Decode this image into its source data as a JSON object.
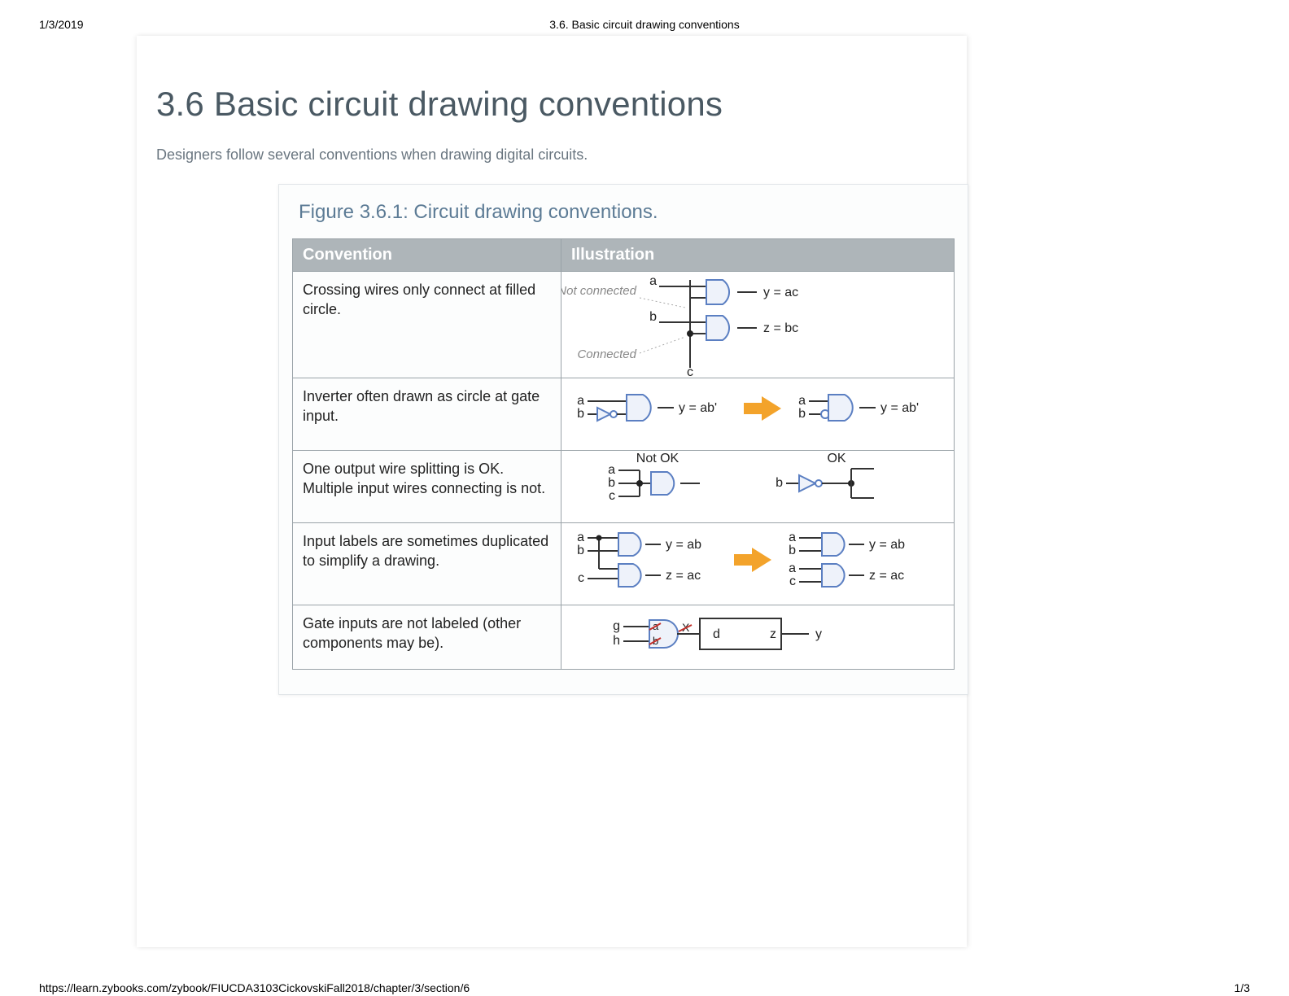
{
  "print": {
    "date": "1/3/2019",
    "header_title": "3.6. Basic circuit drawing conventions",
    "url": "https://learn.zybooks.com/zybook/FIUCDA3103CickovskiFall2018/chapter/3/section/6",
    "page_num": "1/3"
  },
  "title": "3.6 Basic circuit drawing conventions",
  "intro": "Designers follow several conventions when drawing digital circuits.",
  "figure": {
    "caption": "Figure 3.6.1: Circuit drawing conventions.",
    "headers": {
      "col1": "Convention",
      "col2": "Illustration"
    },
    "rows": [
      {
        "desc": "Crossing wires only connect at filled circle.",
        "labels": {
          "notconn": "Not connected",
          "conn": "Connected",
          "a": "a",
          "b": "b",
          "c": "c",
          "y": "y = ac",
          "z": "z = bc"
        }
      },
      {
        "desc": "Inverter often drawn as circle at gate input.",
        "labels": {
          "a": "a",
          "b": "b",
          "y": "y = ab'"
        }
      },
      {
        "desc": "One output wire splitting is OK. Multiple input wires connecting is not.",
        "labels": {
          "notok": "Not OK",
          "ok": "OK",
          "a": "a",
          "b": "b",
          "c": "c"
        }
      },
      {
        "desc": "Input labels are sometimes duplicated to simplify a drawing.",
        "labels": {
          "a": "a",
          "b": "b",
          "c": "c",
          "y": "y = ab",
          "z": "z = ac"
        }
      },
      {
        "desc": "Gate inputs are not labeled (other components may be).",
        "labels": {
          "g": "g",
          "h": "h",
          "d": "d",
          "z": "z",
          "y": "y",
          "xa": "a",
          "xb": "b",
          "xx": "X"
        }
      }
    ]
  }
}
